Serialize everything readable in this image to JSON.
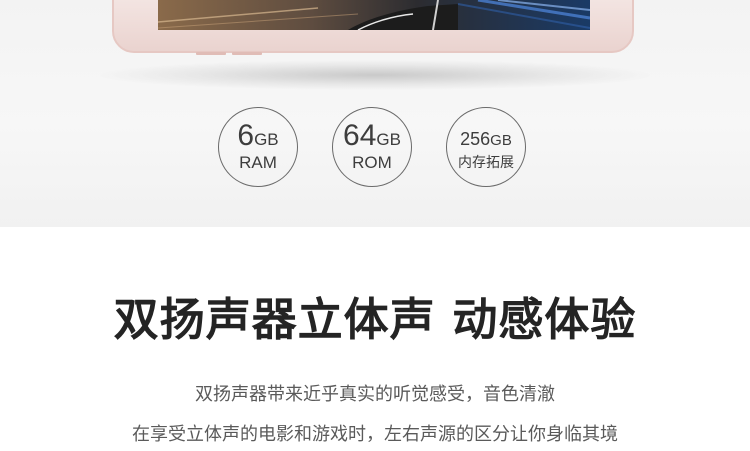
{
  "specs": [
    {
      "number": "6",
      "unit": "GB",
      "label": "RAM"
    },
    {
      "number": "64",
      "unit": "GB",
      "label": "ROM"
    },
    {
      "number": "256",
      "unit": "GB",
      "label": "内存拓展"
    }
  ],
  "headline": "双扬声器立体声 动感体验",
  "description": [
    "双扬声器带来近乎真实的听觉感受，音色清澈",
    "在享受立体声的电影和游戏时，左右声源的区分让你身临其境"
  ],
  "colors": {
    "phone_body": "#ead3cf",
    "text_dark": "#242424",
    "text_gray": "#5a5a5a",
    "badge_border": "#6a6a6a"
  }
}
